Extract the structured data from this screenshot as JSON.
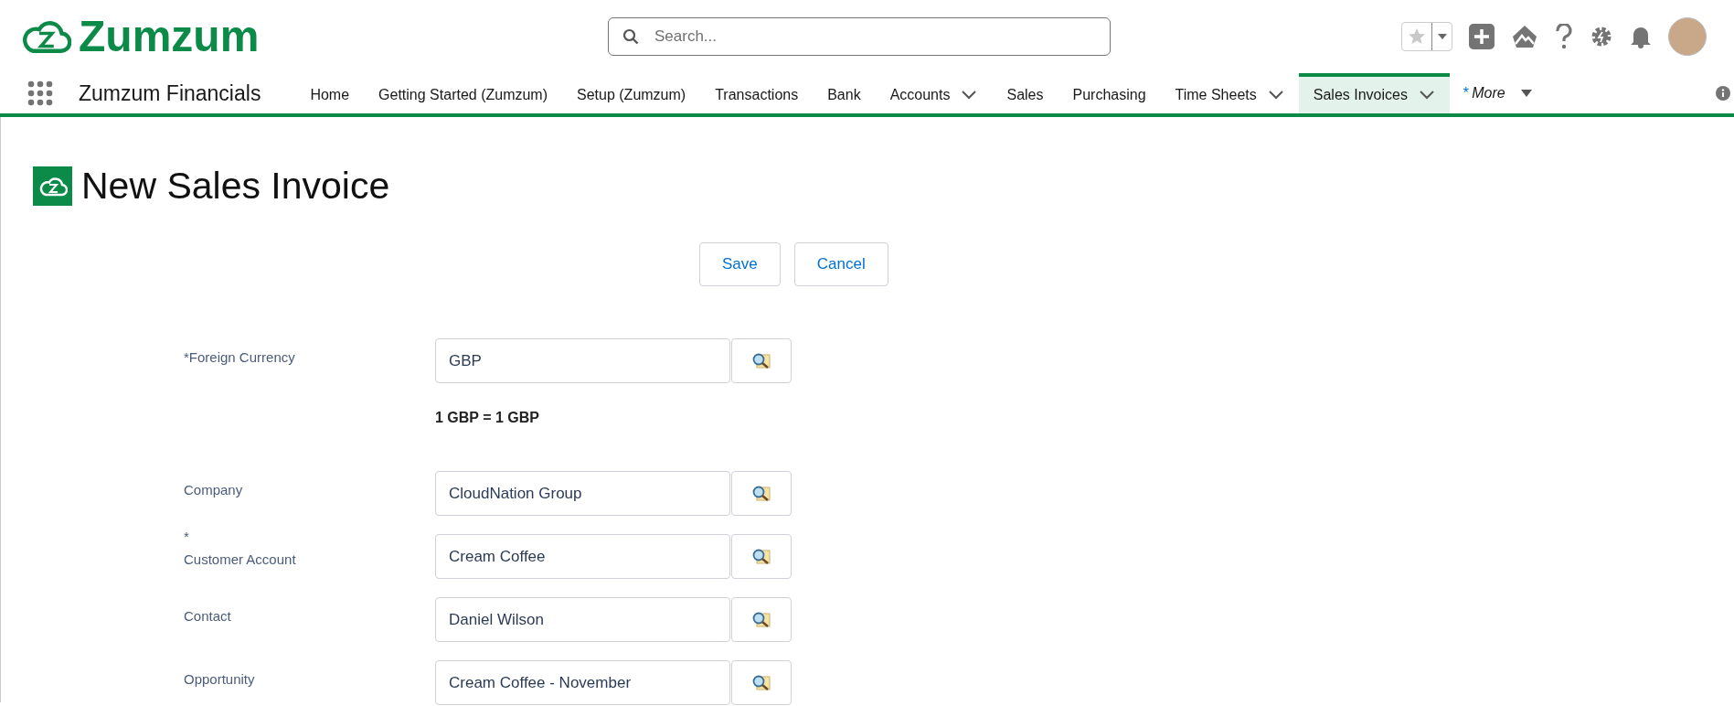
{
  "header": {
    "logo_text": "Zumzum",
    "search": {
      "placeholder": "Search..."
    }
  },
  "nav": {
    "app_name": "Zumzum Financials",
    "items": [
      {
        "label": "Home",
        "dropdown": false,
        "selected": false
      },
      {
        "label": "Getting Started (Zumzum)",
        "dropdown": false,
        "selected": false
      },
      {
        "label": "Setup (Zumzum)",
        "dropdown": false,
        "selected": false
      },
      {
        "label": "Transactions",
        "dropdown": false,
        "selected": false
      },
      {
        "label": "Bank",
        "dropdown": false,
        "selected": false
      },
      {
        "label": "Accounts",
        "dropdown": true,
        "selected": false
      },
      {
        "label": "Sales",
        "dropdown": false,
        "selected": false
      },
      {
        "label": "Purchasing",
        "dropdown": false,
        "selected": false
      },
      {
        "label": "Time Sheets",
        "dropdown": true,
        "selected": false
      },
      {
        "label": "Sales Invoices",
        "dropdown": true,
        "selected": true
      }
    ],
    "more": {
      "marker": "*",
      "label": "More"
    }
  },
  "page": {
    "title": "New Sales Invoice",
    "buttons": [
      "Save",
      "Cancel"
    ]
  },
  "fields": [
    {
      "label": "Foreign Currency",
      "marker": "*",
      "kind": "inline",
      "value": "GBP",
      "note": "1 GBP = 1 GBP"
    },
    {
      "label": "Company",
      "value": "CloudNation Group"
    },
    {
      "label": "Customer Account",
      "marker": "*",
      "kind": "above",
      "value": "Cream Coffee"
    },
    {
      "label": "Contact",
      "value": "Daniel Wilson"
    },
    {
      "label": "Opportunity",
      "value": "Cream Coffee - November"
    }
  ]
}
